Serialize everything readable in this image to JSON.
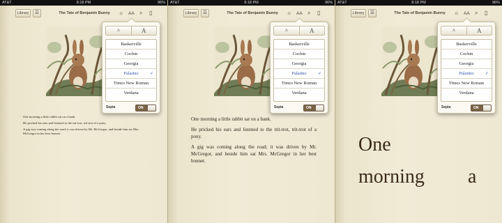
{
  "status": {
    "carrier": "AT&T",
    "time": "8:18 PM",
    "battery": "96%"
  },
  "toolbar": {
    "library_label": "Library",
    "toc_label": "☰",
    "book_title": "The Tale of Benjamin Bunny"
  },
  "popover": {
    "size_small_label": "A",
    "size_large_label": "A",
    "fonts": [
      "Baskerville",
      "Cochin",
      "Georgia",
      "Palatino",
      "Times New Roman",
      "Verdana"
    ],
    "selected_font": "Palatino",
    "check_mark": "✓",
    "sepia_label": "Sepia",
    "sepia_state": "ON"
  },
  "text": {
    "p1": "One morning a little rabbit sat on a bank.",
    "p2": "He pricked his ears and listened to the trit-trot, trit-trot of a pony.",
    "p3": "A gig was coming along the road; it was driven by Mr. McGregor, and beside him sat Mrs. McGregor in her best bonnet.",
    "large_w1": "One",
    "large_w2": "morning",
    "large_w3": "a"
  },
  "icons": {
    "brightness": "☼",
    "font_size": "AA",
    "search": "⌕",
    "bookmark": "▯"
  },
  "colors": {
    "page": "#f1ebd6",
    "sepia_toggle": "#7a6247",
    "selected_font": "#2f57a7"
  }
}
